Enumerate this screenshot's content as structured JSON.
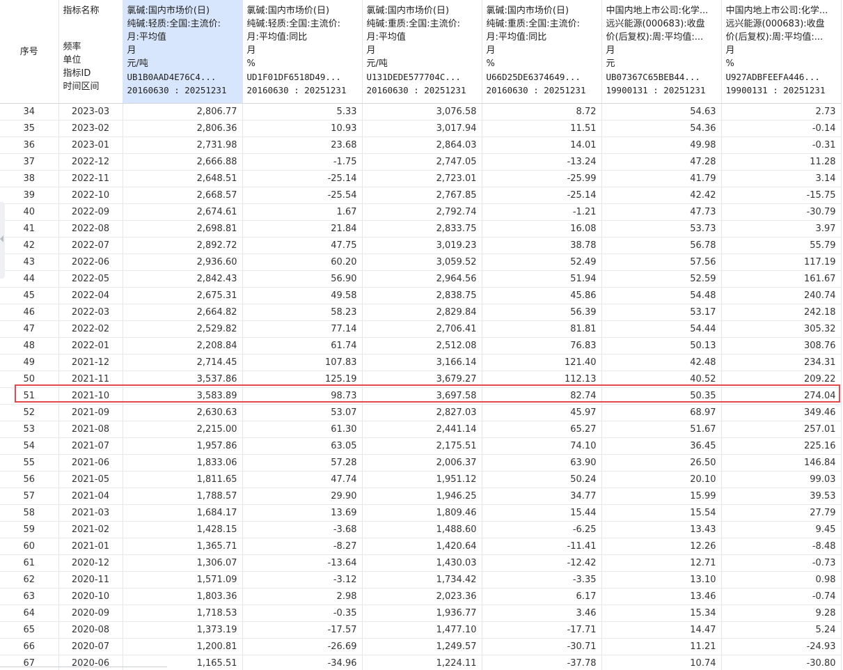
{
  "header": {
    "seq_label": "序号",
    "meta_labels": {
      "name": "指标名称",
      "freq": "频率",
      "unit": "单位",
      "id": "指标ID",
      "range": "时间区间"
    },
    "columns": [
      {
        "name_line1": "氯碱:国内市场价(日)",
        "name_line2": "纯碱:轻质:全国:主流价:",
        "name_line3": "月:平均值",
        "freq": "月",
        "unit": "元/吨",
        "id": "UB1B0AAD4E76C4...",
        "range": "20160630 : 20251231"
      },
      {
        "name_line1": "氯碱:国内市场价(日)",
        "name_line2": "纯碱:轻质:全国:主流价:",
        "name_line3": "月:平均值:同比",
        "freq": "月",
        "unit": "%",
        "id": "UD1F01DF6518D49...",
        "range": "20160630 : 20251231"
      },
      {
        "name_line1": "氯碱:国内市场价(日)",
        "name_line2": "纯碱:重质:全国:主流价:",
        "name_line3": "月:平均值",
        "freq": "月",
        "unit": "元/吨",
        "id": "U131DEDE577704C...",
        "range": "20160630 : 20251231"
      },
      {
        "name_line1": "氯碱:国内市场价(日)",
        "name_line2": "纯碱:重质:全国:主流价:",
        "name_line3": "月:平均值:同比",
        "freq": "月",
        "unit": "%",
        "id": "U66D25DE6374649...",
        "range": "20160630 : 20251231"
      },
      {
        "name_line1": "中国内地上市公司:化学...",
        "name_line2": "远兴能源(000683):收盘",
        "name_line3": "价(后复权):周:平均值:...",
        "freq": "月",
        "unit": "元",
        "id": "UB07367C65BEB44...",
        "range": "19900131 : 20251231"
      },
      {
        "name_line1": "中国内地上市公司:化学...",
        "name_line2": "远兴能源(000683):收盘",
        "name_line3": "价(后复权):周:平均值:...",
        "freq": "月",
        "unit": "%",
        "id": "U927ADBFEEFA446...",
        "range": "19900131 : 20251231"
      }
    ]
  },
  "rows": [
    {
      "seq": "34",
      "date": "2023-03",
      "v": [
        "2,806.77",
        "5.33",
        "3,076.58",
        "8.72",
        "54.63",
        "2.73"
      ]
    },
    {
      "seq": "35",
      "date": "2023-02",
      "v": [
        "2,806.36",
        "10.93",
        "3,017.94",
        "11.51",
        "54.36",
        "-0.14"
      ]
    },
    {
      "seq": "36",
      "date": "2023-01",
      "v": [
        "2,731.98",
        "23.68",
        "2,864.03",
        "14.01",
        "49.98",
        "-0.31"
      ]
    },
    {
      "seq": "37",
      "date": "2022-12",
      "v": [
        "2,666.88",
        "-1.75",
        "2,747.05",
        "-13.24",
        "47.28",
        "11.28"
      ]
    },
    {
      "seq": "38",
      "date": "2022-11",
      "v": [
        "2,648.51",
        "-25.14",
        "2,723.01",
        "-25.99",
        "41.79",
        "3.14"
      ]
    },
    {
      "seq": "39",
      "date": "2022-10",
      "v": [
        "2,668.57",
        "-25.54",
        "2,767.85",
        "-25.14",
        "42.42",
        "-15.75"
      ]
    },
    {
      "seq": "40",
      "date": "2022-09",
      "v": [
        "2,674.61",
        "1.67",
        "2,792.74",
        "-1.21",
        "47.73",
        "-30.79"
      ]
    },
    {
      "seq": "41",
      "date": "2022-08",
      "v": [
        "2,698.81",
        "21.84",
        "2,833.75",
        "16.08",
        "53.73",
        "3.97"
      ]
    },
    {
      "seq": "42",
      "date": "2022-07",
      "v": [
        "2,892.72",
        "47.75",
        "3,019.23",
        "38.78",
        "56.78",
        "55.79"
      ]
    },
    {
      "seq": "43",
      "date": "2022-06",
      "v": [
        "2,936.60",
        "60.20",
        "3,059.52",
        "52.49",
        "57.56",
        "117.19"
      ]
    },
    {
      "seq": "44",
      "date": "2022-05",
      "v": [
        "2,842.43",
        "56.90",
        "2,964.56",
        "51.94",
        "52.59",
        "161.67"
      ]
    },
    {
      "seq": "45",
      "date": "2022-04",
      "v": [
        "2,675.31",
        "49.58",
        "2,838.75",
        "45.86",
        "54.48",
        "240.74"
      ]
    },
    {
      "seq": "46",
      "date": "2022-03",
      "v": [
        "2,664.82",
        "58.23",
        "2,829.84",
        "56.39",
        "53.17",
        "242.18"
      ]
    },
    {
      "seq": "47",
      "date": "2022-02",
      "v": [
        "2,529.82",
        "77.14",
        "2,706.41",
        "81.81",
        "54.44",
        "305.32"
      ]
    },
    {
      "seq": "48",
      "date": "2022-01",
      "v": [
        "2,208.84",
        "61.74",
        "2,512.08",
        "76.83",
        "50.13",
        "308.76"
      ]
    },
    {
      "seq": "49",
      "date": "2021-12",
      "v": [
        "2,714.45",
        "107.83",
        "3,166.14",
        "121.40",
        "42.48",
        "234.31"
      ]
    },
    {
      "seq": "50",
      "date": "2021-11",
      "v": [
        "3,537.86",
        "125.19",
        "3,679.27",
        "112.13",
        "40.52",
        "209.22"
      ]
    },
    {
      "seq": "51",
      "date": "2021-10",
      "v": [
        "3,583.89",
        "98.73",
        "3,697.58",
        "82.74",
        "50.35",
        "274.04"
      ]
    },
    {
      "seq": "52",
      "date": "2021-09",
      "v": [
        "2,630.63",
        "53.07",
        "2,827.03",
        "45.97",
        "68.97",
        "349.46"
      ]
    },
    {
      "seq": "53",
      "date": "2021-08",
      "v": [
        "2,215.00",
        "61.30",
        "2,441.14",
        "65.27",
        "51.67",
        "257.01"
      ]
    },
    {
      "seq": "54",
      "date": "2021-07",
      "v": [
        "1,957.86",
        "63.05",
        "2,175.51",
        "74.10",
        "36.45",
        "225.16"
      ]
    },
    {
      "seq": "55",
      "date": "2021-06",
      "v": [
        "1,833.06",
        "57.28",
        "2,006.37",
        "63.90",
        "26.50",
        "146.84"
      ]
    },
    {
      "seq": "56",
      "date": "2021-05",
      "v": [
        "1,811.65",
        "47.74",
        "1,951.12",
        "50.24",
        "20.10",
        "99.03"
      ]
    },
    {
      "seq": "57",
      "date": "2021-04",
      "v": [
        "1,788.57",
        "29.90",
        "1,946.25",
        "34.77",
        "15.99",
        "39.53"
      ]
    },
    {
      "seq": "58",
      "date": "2021-03",
      "v": [
        "1,684.17",
        "13.69",
        "1,809.46",
        "15.44",
        "15.54",
        "27.79"
      ]
    },
    {
      "seq": "59",
      "date": "2021-02",
      "v": [
        "1,428.15",
        "-3.68",
        "1,488.60",
        "-6.25",
        "13.43",
        "9.45"
      ]
    },
    {
      "seq": "60",
      "date": "2021-01",
      "v": [
        "1,365.71",
        "-8.27",
        "1,420.64",
        "-11.41",
        "12.26",
        "-8.48"
      ]
    },
    {
      "seq": "61",
      "date": "2020-12",
      "v": [
        "1,306.07",
        "-13.64",
        "1,430.03",
        "-12.42",
        "12.71",
        "-0.73"
      ]
    },
    {
      "seq": "62",
      "date": "2020-11",
      "v": [
        "1,571.09",
        "-3.12",
        "1,734.42",
        "-3.35",
        "13.10",
        "0.98"
      ]
    },
    {
      "seq": "63",
      "date": "2020-10",
      "v": [
        "1,803.36",
        "2.98",
        "2,023.36",
        "6.17",
        "13.46",
        "-0.74"
      ]
    },
    {
      "seq": "64",
      "date": "2020-09",
      "v": [
        "1,718.53",
        "-0.35",
        "1,936.77",
        "3.46",
        "15.34",
        "9.28"
      ]
    },
    {
      "seq": "65",
      "date": "2020-08",
      "v": [
        "1,373.19",
        "-17.57",
        "1,477.10",
        "-17.71",
        "14.47",
        "5.24"
      ]
    },
    {
      "seq": "66",
      "date": "2020-07",
      "v": [
        "1,200.81",
        "-26.69",
        "1,249.57",
        "-30.71",
        "11.21",
        "-24.93"
      ]
    },
    {
      "seq": "67",
      "date": "2020-06",
      "v": [
        "1,165.51",
        "-34.96",
        "1,224.11",
        "-37.78",
        "10.74",
        "-30.80"
      ]
    }
  ],
  "selected_column_index": 0,
  "highlighted_row_seq": "51",
  "colors": {
    "selected_header_bg": "#d7e6fc",
    "highlight_border": "#e5474b",
    "grid_line": "#e3e5ea",
    "text": "#333333"
  }
}
